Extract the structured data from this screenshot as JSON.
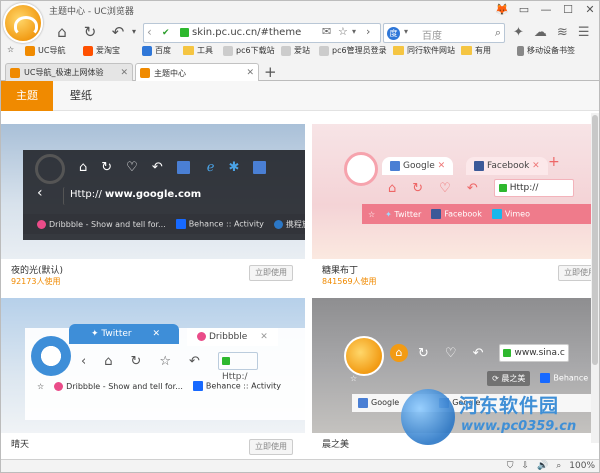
{
  "window": {
    "title": "主题中心 - UC浏览器"
  },
  "titlebar": {
    "controls": [
      "🦊",
      "▭",
      "—",
      "☐",
      "✕"
    ]
  },
  "nav": {
    "url": "skin.pc.uc.cn/#theme",
    "search_engine": "百度",
    "search_placeholder": "百度"
  },
  "bookmarks": [
    {
      "label": "UC导航",
      "color": "#f08a00",
      "icon": "uc-icon"
    },
    {
      "label": "爱淘宝",
      "color": "#ff5000",
      "icon": "taobao-icon"
    },
    {
      "label": "百度",
      "color": "#2f77d8",
      "icon": "baidu-icon"
    },
    {
      "label": "工具",
      "color": "folder",
      "icon": "folder-icon"
    },
    {
      "label": "pc6下载站",
      "color": "#bbbbbb",
      "icon": "page-icon"
    },
    {
      "label": "爱站",
      "color": "#bbbbbb",
      "icon": "page-icon"
    },
    {
      "label": "pc6管理员登录",
      "color": "#bbbbbb",
      "icon": "page-icon"
    },
    {
      "label": "同行软件网站",
      "color": "folder",
      "icon": "folder-icon"
    },
    {
      "label": "有用",
      "color": "folder",
      "icon": "folder-icon"
    },
    {
      "label": "移动设备书签",
      "color": "#888888",
      "icon": "mobile-icon"
    }
  ],
  "tabs": [
    {
      "label": "UC导航_极速上网体验",
      "active": false
    },
    {
      "label": "主题中心",
      "active": true
    }
  ],
  "subtabs": {
    "theme": "主题",
    "wallpaper": "壁纸"
  },
  "themes": [
    {
      "name": "夜的光(默认)",
      "users": "92173人使用",
      "button": "立即使用",
      "preview": {
        "url_prefix": "Http://",
        "url_domain": "www.google.com",
        "bookmarks": [
          "Dribbble - Show and tell for...",
          "Behance :: Activity",
          "携程旅行网"
        ]
      }
    },
    {
      "name": "糖果布丁",
      "users": "841569人使用",
      "button": "立即使用",
      "preview": {
        "tabs": [
          "Google",
          "Facebook"
        ],
        "url_prefix": "Http://",
        "url_domain": "",
        "bookmarks": [
          "Twitter",
          "Facebook",
          "Vimeo"
        ]
      }
    },
    {
      "name": "晴天",
      "users": "",
      "button": "立即使用",
      "preview": {
        "tabs": [
          "Twitter",
          "Dribbble"
        ],
        "url_prefix": "Http:/",
        "bookmarks": [
          "Dribbble - Show and tell for...",
          "Behance :: Activity"
        ]
      }
    },
    {
      "name": "晨之美",
      "users": "",
      "button": "",
      "preview": {
        "url_domain": "www.sina.c",
        "bookmarks": [
          "Behance :: Activity"
        ],
        "tabs": [
          "Google",
          "Google"
        ],
        "badge": "晨之美"
      }
    }
  ],
  "statusbar": {
    "zoom": "100%"
  },
  "watermark": {
    "title": "河东软件园",
    "url": "www.pc0359.cn"
  }
}
